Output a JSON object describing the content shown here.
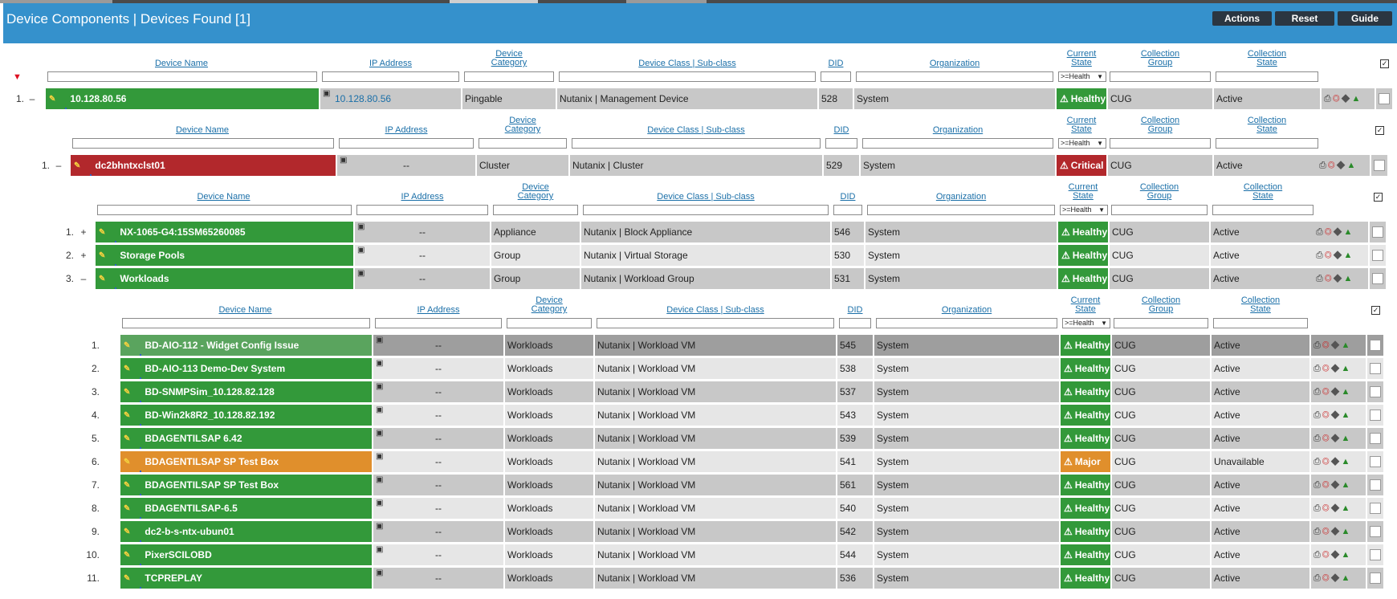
{
  "title": "Device Components | Devices Found [1]",
  "buttons": {
    "actions": "Actions",
    "reset": "Reset",
    "guide": "Guide"
  },
  "headers": {
    "device_name": "Device Name",
    "sort_arrow": "▾",
    "ip_address": "IP Address",
    "device_category_1": "Device",
    "device_category_2": "Category",
    "device_class": "Device Class | Sub-class",
    "did": "DID",
    "organization": "Organization",
    "current_state_1": "Current",
    "current_state_2": "State",
    "collection_group_1": "Collection",
    "collection_group_2": "Group",
    "collection_state_1": "Collection",
    "collection_state_2": "State",
    "state_filter": ">=Health"
  },
  "colors": {
    "healthy": "#33993a",
    "critical": "#b2282c",
    "major": "#e08f2c",
    "header_bar": "#3591cc",
    "link": "#1a6fa8"
  },
  "icons": [
    "filter-icon",
    "wrench-icon",
    "signal-bars-icon",
    "network-icon",
    "printer-icon",
    "lifebuoy-icon",
    "tag-icon",
    "topology-icon",
    "checkbox-icon"
  ],
  "level1": {
    "rows": [
      {
        "num": "1.",
        "toggle": "–",
        "name": "10.128.80.56",
        "ip": "10.128.80.56",
        "category": "Pingable",
        "class": "Nutanix | Management Device",
        "did": "528",
        "org": "System",
        "state": "Healthy",
        "group": "CUG",
        "cstate": "Active"
      }
    ]
  },
  "level2": {
    "rows": [
      {
        "num": "1.",
        "toggle": "–",
        "name": "dc2bhntxclst01",
        "ip": "--",
        "category": "Cluster",
        "class": "Nutanix | Cluster",
        "did": "529",
        "org": "System",
        "state": "Critical",
        "group": "CUG",
        "cstate": "Active"
      }
    ]
  },
  "level3": {
    "rows": [
      {
        "num": "1.",
        "toggle": "+",
        "name": "NX-1065-G4:15SM65260085",
        "ip": "--",
        "category": "Appliance",
        "class": "Nutanix | Block Appliance",
        "did": "546",
        "org": "System",
        "state": "Healthy",
        "group": "CUG",
        "cstate": "Active"
      },
      {
        "num": "2.",
        "toggle": "+",
        "name": "Storage Pools",
        "ip": "--",
        "category": "Group",
        "class": "Nutanix | Virtual Storage",
        "did": "530",
        "org": "System",
        "state": "Healthy",
        "group": "CUG",
        "cstate": "Active"
      },
      {
        "num": "3.",
        "toggle": "–",
        "name": "Workloads",
        "ip": "--",
        "category": "Group",
        "class": "Nutanix | Workload Group",
        "did": "531",
        "org": "System",
        "state": "Healthy",
        "group": "CUG",
        "cstate": "Active"
      }
    ]
  },
  "level4": {
    "rows": [
      {
        "num": "1.",
        "name": "BD-AIO-112 - Widget Config Issue",
        "ip": "--",
        "category": "Workloads",
        "class": "Nutanix | Workload VM",
        "did": "545",
        "org": "System",
        "state": "Healthy",
        "group": "CUG",
        "cstate": "Active"
      },
      {
        "num": "2.",
        "name": "BD-AIO-113 Demo-Dev System",
        "ip": "--",
        "category": "Workloads",
        "class": "Nutanix | Workload VM",
        "did": "538",
        "org": "System",
        "state": "Healthy",
        "group": "CUG",
        "cstate": "Active"
      },
      {
        "num": "3.",
        "name": "BD-SNMPSim_10.128.82.128",
        "ip": "--",
        "category": "Workloads",
        "class": "Nutanix | Workload VM",
        "did": "537",
        "org": "System",
        "state": "Healthy",
        "group": "CUG",
        "cstate": "Active"
      },
      {
        "num": "4.",
        "name": "BD-Win2k8R2_10.128.82.192",
        "ip": "--",
        "category": "Workloads",
        "class": "Nutanix | Workload VM",
        "did": "543",
        "org": "System",
        "state": "Healthy",
        "group": "CUG",
        "cstate": "Active"
      },
      {
        "num": "5.",
        "name": "BDAGENTILSAP 6.42",
        "ip": "--",
        "category": "Workloads",
        "class": "Nutanix | Workload VM",
        "did": "539",
        "org": "System",
        "state": "Healthy",
        "group": "CUG",
        "cstate": "Active"
      },
      {
        "num": "6.",
        "name": "BDAGENTILSAP SP Test Box",
        "ip": "--",
        "category": "Workloads",
        "class": "Nutanix | Workload VM",
        "did": "541",
        "org": "System",
        "state": "Major",
        "group": "CUG",
        "cstate": "Unavailable"
      },
      {
        "num": "7.",
        "name": "BDAGENTILSAP SP Test Box",
        "ip": "--",
        "category": "Workloads",
        "class": "Nutanix | Workload VM",
        "did": "561",
        "org": "System",
        "state": "Healthy",
        "group": "CUG",
        "cstate": "Active"
      },
      {
        "num": "8.",
        "name": "BDAGENTILSAP-6.5",
        "ip": "--",
        "category": "Workloads",
        "class": "Nutanix | Workload VM",
        "did": "540",
        "org": "System",
        "state": "Healthy",
        "group": "CUG",
        "cstate": "Active"
      },
      {
        "num": "9.",
        "name": "dc2-b-s-ntx-ubun01",
        "ip": "--",
        "category": "Workloads",
        "class": "Nutanix | Workload VM",
        "did": "542",
        "org": "System",
        "state": "Healthy",
        "group": "CUG",
        "cstate": "Active"
      },
      {
        "num": "10.",
        "name": "PixerSCILOBD",
        "ip": "--",
        "category": "Workloads",
        "class": "Nutanix | Workload VM",
        "did": "544",
        "org": "System",
        "state": "Healthy",
        "group": "CUG",
        "cstate": "Active"
      },
      {
        "num": "11.",
        "name": "TCPREPLAY",
        "ip": "--",
        "category": "Workloads",
        "class": "Nutanix | Workload VM",
        "did": "536",
        "org": "System",
        "state": "Healthy",
        "group": "CUG",
        "cstate": "Active"
      }
    ]
  }
}
